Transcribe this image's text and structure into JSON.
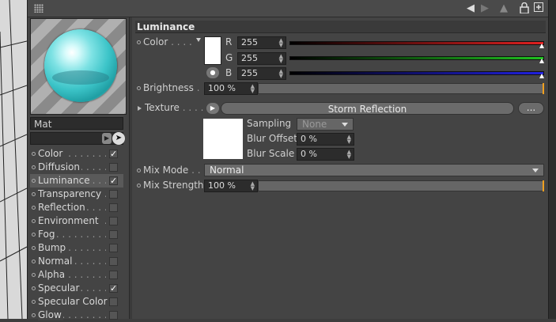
{
  "material": {
    "name": "Mat",
    "channels": [
      {
        "label": "Color",
        "checked": true,
        "active": false
      },
      {
        "label": "Diffusion",
        "checked": false,
        "active": false
      },
      {
        "label": "Luminance",
        "checked": true,
        "active": true
      },
      {
        "label": "Transparency",
        "checked": false,
        "active": false
      },
      {
        "label": "Reflection",
        "checked": false,
        "active": false
      },
      {
        "label": "Environment",
        "checked": false,
        "active": false
      },
      {
        "label": "Fog",
        "checked": false,
        "active": false
      },
      {
        "label": "Bump",
        "checked": false,
        "active": false
      },
      {
        "label": "Normal",
        "checked": false,
        "active": false
      },
      {
        "label": "Alpha",
        "checked": false,
        "active": false
      },
      {
        "label": "Specular",
        "checked": true,
        "active": false
      },
      {
        "label": "Specular Color",
        "checked": false,
        "active": false
      },
      {
        "label": "Glow",
        "checked": false,
        "active": false
      }
    ]
  },
  "titlebar": {
    "icons": [
      "back-arrow-icon",
      "forward-arrow-icon",
      "lock-icon",
      "new-window-icon"
    ]
  },
  "luminance": {
    "title": "Luminance",
    "color": {
      "label": "Color",
      "r_label": "R",
      "g_label": "G",
      "b_label": "B",
      "r": "255",
      "g": "255",
      "b": "255",
      "swatch": "#ffffff"
    },
    "brightness": {
      "label": "Brightness",
      "value": "100 %",
      "percent": 100
    },
    "texture": {
      "label": "Texture",
      "name": "Storm Reflection",
      "more": "...",
      "sampling_label": "Sampling",
      "sampling_value": "None",
      "blur_offset_label": "Blur Offset",
      "blur_offset_value": "0 %",
      "blur_scale_label": "Blur Scale",
      "blur_scale_value": "0 %"
    },
    "mix_mode": {
      "label": "Mix Mode",
      "value": "Normal"
    },
    "mix_strength": {
      "label": "Mix Strength",
      "value": "100 %",
      "percent": 100
    }
  },
  "colors": {
    "red_slider": "#e02020",
    "green_slider": "#20c020",
    "blue_slider": "#2020e0",
    "accent": "#f0a020",
    "sphere": "#3cc4c8"
  }
}
